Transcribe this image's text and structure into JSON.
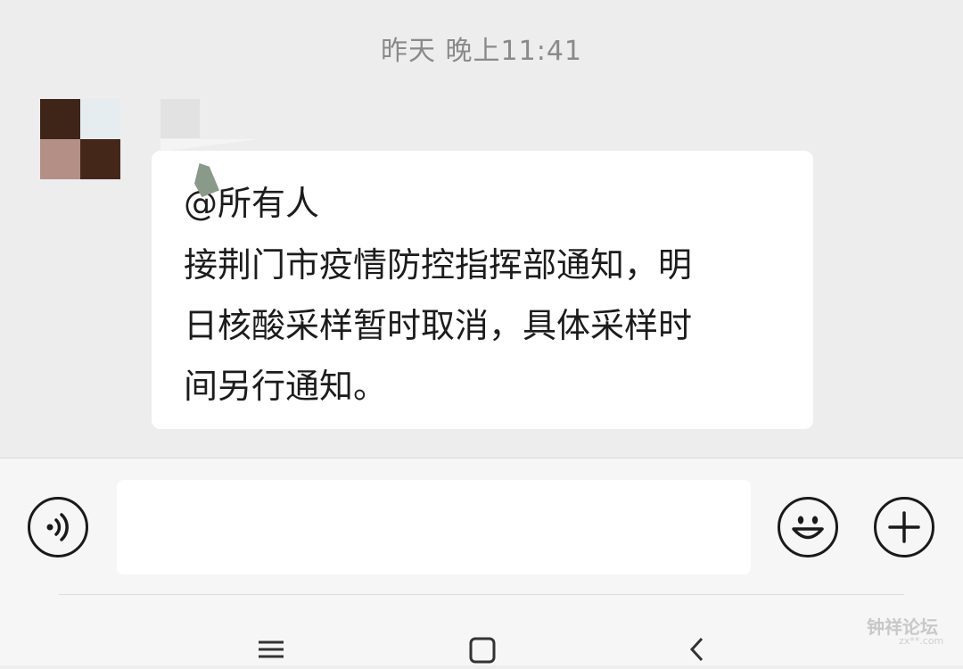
{
  "chat": {
    "timestamp": "昨天 晚上11:41",
    "message": {
      "mention": "@所有人",
      "lines": [
        "接荆门市疫情防控指挥部通知，明",
        "日核酸采样暂时取消，具体采样时",
        "间另行通知。"
      ]
    }
  },
  "avatar": {
    "colors": [
      "#3f2418",
      "#e6edf0",
      "#b48f86",
      "#45271a"
    ]
  },
  "input_bar": {
    "input_value": "",
    "voice_icon": "voice-icon",
    "emoji_icon": "smiley-face-icon",
    "plus_icon": "plus-icon"
  },
  "nav": {
    "menu_icon": "menu-icon",
    "home_icon": "home-square-icon",
    "back_icon": "back-chevron-icon"
  },
  "watermark": {
    "text": "钟祥论坛",
    "sub": "zx**.com"
  }
}
